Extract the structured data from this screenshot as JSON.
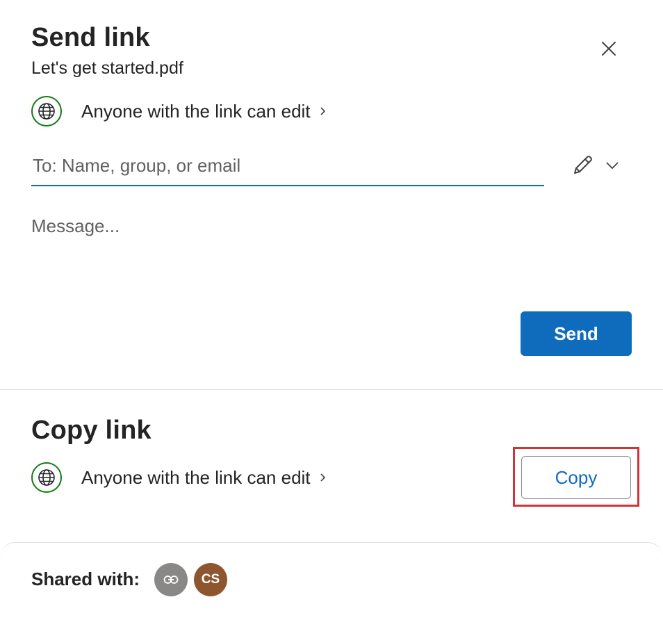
{
  "send": {
    "title": "Send link",
    "file_name": "Let's get started.pdf",
    "permission": "Anyone with the link can edit",
    "to_placeholder": "To: Name, group, or email",
    "message_placeholder": "Message...",
    "send_label": "Send"
  },
  "copy": {
    "title": "Copy link",
    "permission": "Anyone with the link can edit",
    "copy_label": "Copy"
  },
  "footer": {
    "shared_label": "Shared with:",
    "avatars": [
      {
        "kind": "link",
        "icon": "link-icon",
        "color": "#8a8886"
      },
      {
        "kind": "user",
        "initials": "CS",
        "color": "#8e562e"
      }
    ]
  },
  "colors": {
    "accent": "#0f6cbd",
    "globe": "#107c10",
    "highlight": "#d13438"
  },
  "icons": {
    "close": "close-icon",
    "globe": "globe-icon",
    "chevron": "chevron-right-icon",
    "pencil": "pencil-icon",
    "dropdown": "chevron-down-icon"
  }
}
